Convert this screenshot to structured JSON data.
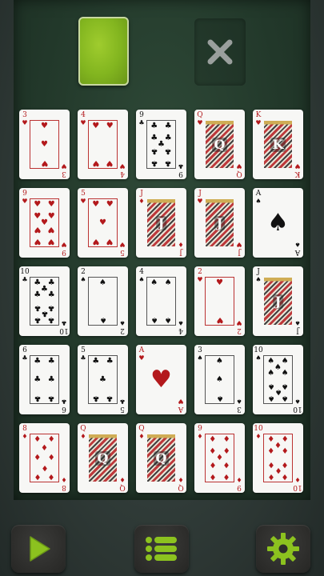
{
  "colors": {
    "accent": "#8cc21f",
    "felt": "#22382a",
    "red_suit": "#b3191c",
    "black_suit": "#111111"
  },
  "top_bar": {
    "deck_icon": "card-back",
    "discard_icon": "x-icon"
  },
  "board": {
    "rows": [
      [
        {
          "rank": "3",
          "suit": "♥",
          "color": "red"
        },
        {
          "rank": "4",
          "suit": "♥",
          "color": "red"
        },
        {
          "rank": "9",
          "suit": "♣",
          "color": "black"
        },
        {
          "rank": "Q",
          "suit": "♥",
          "color": "red"
        },
        {
          "rank": "K",
          "suit": "♥",
          "color": "red"
        }
      ],
      [
        {
          "rank": "9",
          "suit": "♥",
          "color": "red"
        },
        {
          "rank": "5",
          "suit": "♥",
          "color": "red"
        },
        {
          "rank": "J",
          "suit": "♦",
          "color": "red"
        },
        {
          "rank": "J",
          "suit": "♥",
          "color": "red"
        },
        {
          "rank": "A",
          "suit": "♠",
          "color": "black"
        }
      ],
      [
        {
          "rank": "10",
          "suit": "♣",
          "color": "black"
        },
        {
          "rank": "2",
          "suit": "♠",
          "color": "black"
        },
        {
          "rank": "4",
          "suit": "♠",
          "color": "black"
        },
        {
          "rank": "2",
          "suit": "♥",
          "color": "red"
        },
        {
          "rank": "J",
          "suit": "♠",
          "color": "black"
        }
      ],
      [
        {
          "rank": "6",
          "suit": "♣",
          "color": "black"
        },
        {
          "rank": "5",
          "suit": "♣",
          "color": "black"
        },
        {
          "rank": "A",
          "suit": "♥",
          "color": "red"
        },
        {
          "rank": "3",
          "suit": "♠",
          "color": "black"
        },
        {
          "rank": "10",
          "suit": "♠",
          "color": "black"
        }
      ],
      [
        {
          "rank": "8",
          "suit": "♦",
          "color": "red"
        },
        {
          "rank": "Q",
          "suit": "♦",
          "color": "red"
        },
        {
          "rank": "Q",
          "suit": "♦",
          "color": "red"
        },
        {
          "rank": "9",
          "suit": "♦",
          "color": "red"
        },
        {
          "rank": "10",
          "suit": "♦",
          "color": "red"
        }
      ]
    ]
  },
  "bottom_bar": {
    "buttons": [
      {
        "name": "play-button",
        "icon": "play-icon"
      },
      {
        "name": "menu-button",
        "icon": "menu-icon"
      },
      {
        "name": "settings-button",
        "icon": "gear-icon"
      }
    ]
  }
}
